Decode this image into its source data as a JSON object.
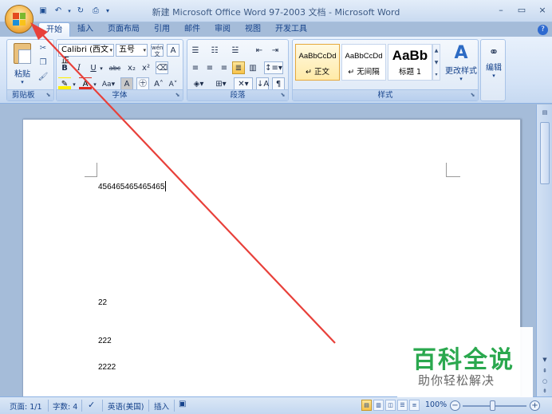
{
  "window": {
    "title": "新建 Microsoft Office Word 97-2003 文档 - Microsoft Word",
    "controls": [
      "–",
      "▭",
      "×"
    ]
  },
  "quick_access": [
    "save-icon",
    "undo-icon",
    "redo-icon",
    "print-preview-icon"
  ],
  "tabs": [
    "开始",
    "插入",
    "页面布局",
    "引用",
    "邮件",
    "审阅",
    "视图",
    "开发工具"
  ],
  "active_tab": "开始",
  "ribbon": {
    "clipboard": {
      "label": "剪贴板",
      "paste": "粘贴"
    },
    "font": {
      "label": "字体",
      "font_name": "Calibri (西文正",
      "font_size": "五号",
      "wen": "wén",
      "A": "A"
    },
    "paragraph": {
      "label": "段落"
    },
    "styles": {
      "label": "样式",
      "tiles": [
        {
          "preview": "AaBbCcDd",
          "name": "↵ 正文"
        },
        {
          "preview": "AaBbCcDd",
          "name": "↵ 无间隔"
        },
        {
          "preview": "AaBb",
          "name": "标题 1"
        }
      ],
      "change_styles": "更改样式"
    },
    "editing": {
      "label": "编辑"
    }
  },
  "document": {
    "lines": [
      "456465465465465",
      "22",
      "222",
      "2222"
    ]
  },
  "status": {
    "page": "页面: 1/1",
    "words": "字数: 4",
    "language": "英语(美国)",
    "mode": "插入",
    "zoom": "100%"
  },
  "watermark": {
    "title": "百科全说",
    "subtitle": "助你轻松解决"
  },
  "colors": {
    "annotation_arrow": "#e8403a",
    "watermark_green": "#2aa84e"
  }
}
